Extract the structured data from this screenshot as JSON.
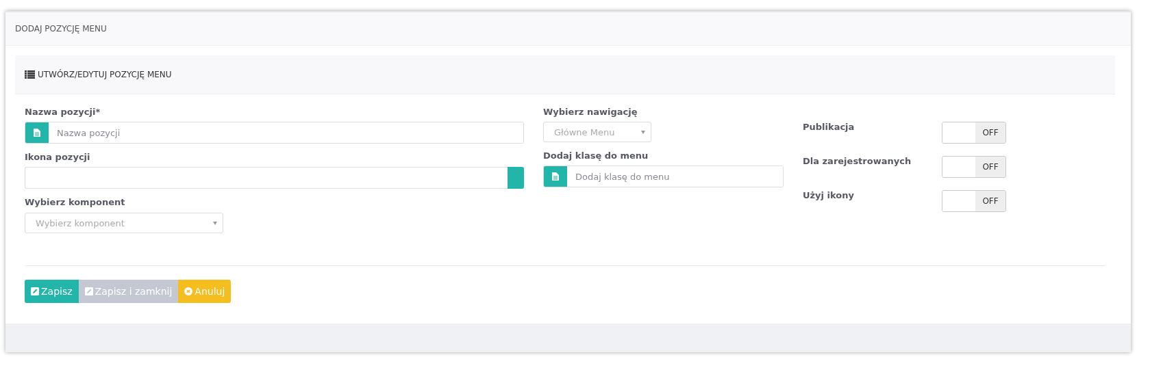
{
  "page": {
    "title": "DODAJ POZYCJĘ MENU"
  },
  "panel": {
    "title": "UTWÓRZ/EDYTUJ POZYCJĘ MENU"
  },
  "column_1": [
    {
      "kind": "text",
      "label": "Nazwa pozycji*",
      "placeholder": "Nazwa pozycji"
    },
    {
      "kind": "icon_picker",
      "label": "Ikona pozycji"
    },
    {
      "kind": "select",
      "label": "Wybierz komponent",
      "value": "Wybierz komponent"
    }
  ],
  "column_2": [
    {
      "kind": "select",
      "label": "Wybierz nawigację",
      "value": "Główne Menu"
    },
    {
      "kind": "text",
      "label": "Dodaj klasę do menu",
      "placeholder": "Dodaj klasę do menu"
    }
  ],
  "switches": [
    {
      "label": "Publikacja",
      "on": false,
      "state": "OFF"
    },
    {
      "label": "Dla zarejestrowanych",
      "on": false,
      "state": "OFF"
    },
    {
      "label": "Użyj ikony",
      "on": false,
      "state": "OFF"
    }
  ],
  "buttons": [
    {
      "kind": "save",
      "label": "Zapisz",
      "disabled": false
    },
    {
      "kind": "save",
      "label": "Zapisz i zamknij",
      "disabled": true
    },
    {
      "kind": "cancel",
      "label": "Anuluj",
      "disabled": false
    }
  ]
}
